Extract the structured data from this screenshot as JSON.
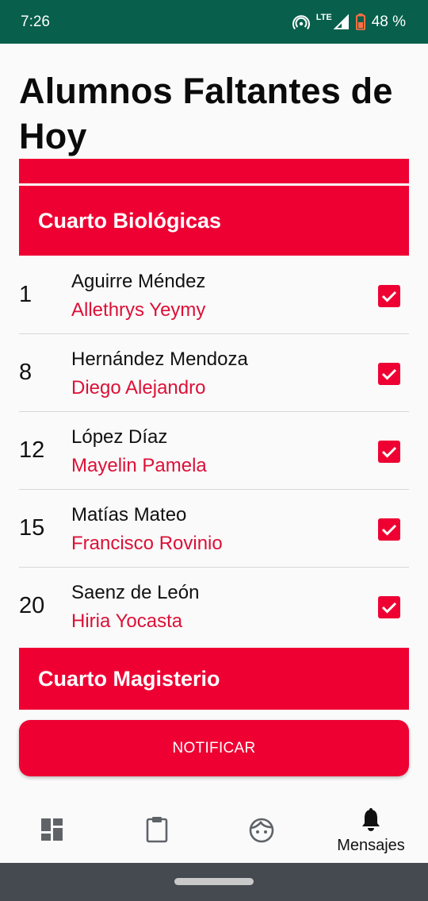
{
  "status_bar": {
    "time": "7:26",
    "network": "LTE",
    "battery": "48 %"
  },
  "page": {
    "title": "Alumnos Faltantes de Hoy"
  },
  "sections": [
    {
      "title": "Cuarto Biológicas",
      "students": [
        {
          "number": "1",
          "last_name": "Aguirre Méndez",
          "first_name": "Allethrys Yeymy",
          "checked": true
        },
        {
          "number": "8",
          "last_name": "Hernández Mendoza",
          "first_name": "Diego Alejandro",
          "checked": true
        },
        {
          "number": "12",
          "last_name": "López Díaz",
          "first_name": "Mayelin Pamela",
          "checked": true
        },
        {
          "number": "15",
          "last_name": "Matías Mateo",
          "first_name": "Francisco Rovinio",
          "checked": true
        },
        {
          "number": "20",
          "last_name": "Saenz de León",
          "first_name": "Hiria Yocasta",
          "checked": true
        }
      ]
    },
    {
      "title": "Cuarto Magisterio",
      "students": []
    }
  ],
  "actions": {
    "notify_label": "NOTIFICAR"
  },
  "bottom_nav": {
    "items": [
      {
        "icon": "dashboard-icon",
        "label": ""
      },
      {
        "icon": "clipboard-icon",
        "label": ""
      },
      {
        "icon": "face-icon",
        "label": ""
      },
      {
        "icon": "bell-icon",
        "label": "Mensajes",
        "active": true
      }
    ]
  },
  "colors": {
    "accent": "#ee0033",
    "status_bar": "#075f4c",
    "name_highlight": "#dc1037"
  }
}
